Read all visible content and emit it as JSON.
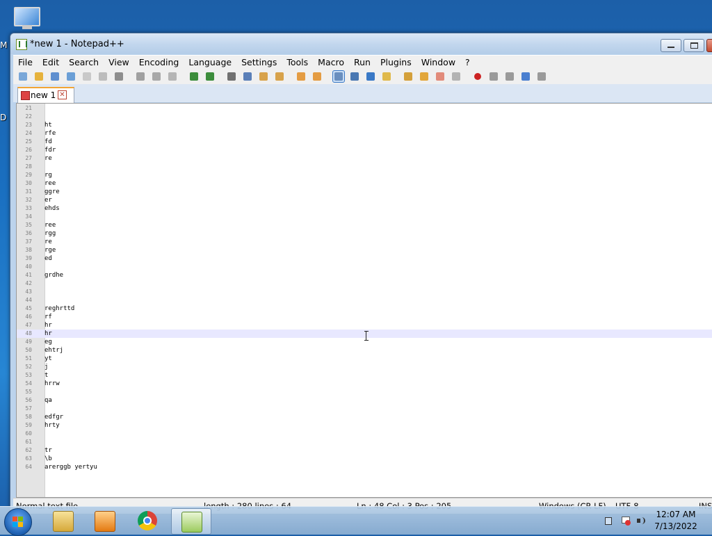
{
  "window": {
    "title": "*new 1 - Notepad++"
  },
  "desktop": {
    "left_letters": [
      "M",
      "D"
    ]
  },
  "menu": [
    "File",
    "Edit",
    "Search",
    "View",
    "Encoding",
    "Language",
    "Settings",
    "Tools",
    "Macro",
    "Run",
    "Plugins",
    "Window",
    "?"
  ],
  "toolbar_icons": [
    "new-file-icon",
    "open-file-icon",
    "save-icon",
    "save-all-icon",
    "close-icon",
    "close-all-icon",
    "print-icon",
    "cut-icon",
    "copy-icon",
    "paste-icon",
    "undo-icon",
    "redo-icon",
    "find-icon",
    "replace-icon",
    "zoom-in-icon",
    "zoom-out-icon",
    "sync-vertical-icon",
    "sync-horizontal-icon",
    "word-wrap-icon",
    "show-all-chars-icon",
    "indent-guide-icon",
    "user-language-icon",
    "doc-map-icon",
    "function-list-icon",
    "folder-workspace-icon",
    "monitoring-icon",
    "record-macro-icon",
    "stop-macro-icon",
    "play-macro-icon",
    "run-macro-multiple-icon",
    "save-macro-icon"
  ],
  "tab": {
    "label": "new 1"
  },
  "editor": {
    "current_line": 48,
    "lines": [
      {
        "n": "21",
        "t": ""
      },
      {
        "n": "22",
        "t": ""
      },
      {
        "n": "23",
        "t": "ht"
      },
      {
        "n": "24",
        "t": "rfe"
      },
      {
        "n": "25",
        "t": "fd"
      },
      {
        "n": "26",
        "t": "fdr"
      },
      {
        "n": "27",
        "t": "re"
      },
      {
        "n": "28",
        "t": ""
      },
      {
        "n": "29",
        "t": "rg"
      },
      {
        "n": "30",
        "t": "ree"
      },
      {
        "n": "31",
        "t": "ggre"
      },
      {
        "n": "32",
        "t": "er"
      },
      {
        "n": "33",
        "t": "ehds"
      },
      {
        "n": "34",
        "t": ""
      },
      {
        "n": "35",
        "t": "ree"
      },
      {
        "n": "36",
        "t": "rgg"
      },
      {
        "n": "37",
        "t": "re"
      },
      {
        "n": "38",
        "t": "rge"
      },
      {
        "n": "39",
        "t": "ed"
      },
      {
        "n": "40",
        "t": ""
      },
      {
        "n": "41",
        "t": "grdhe"
      },
      {
        "n": "42",
        "t": ""
      },
      {
        "n": "43",
        "t": ""
      },
      {
        "n": "44",
        "t": ""
      },
      {
        "n": "45",
        "t": "reghrttd"
      },
      {
        "n": "46",
        "t": "rf"
      },
      {
        "n": "47",
        "t": "hr"
      },
      {
        "n": "48",
        "t": "hr"
      },
      {
        "n": "49",
        "t": "eg"
      },
      {
        "n": "50",
        "t": "ehtrj"
      },
      {
        "n": "51",
        "t": "yt"
      },
      {
        "n": "52",
        "t": "j"
      },
      {
        "n": "53",
        "t": "t"
      },
      {
        "n": "54",
        "t": "hrrw"
      },
      {
        "n": "55",
        "t": ""
      },
      {
        "n": "56",
        "t": "qa"
      },
      {
        "n": "57",
        "t": ""
      },
      {
        "n": "58",
        "t": "edfgr"
      },
      {
        "n": "59",
        "t": "hrty"
      },
      {
        "n": "60",
        "t": ""
      },
      {
        "n": "61",
        "t": ""
      },
      {
        "n": "62",
        "t": "tr"
      },
      {
        "n": "63",
        "t": "\\b"
      },
      {
        "n": "64",
        "t": "arerggb yertyu"
      }
    ]
  },
  "status": {
    "file_type": "Normal text file",
    "length_lines": "length : 280    lines : 64",
    "position": "Ln : 48    Col : 3    Pos : 205",
    "eol": "Windows (CR LF)",
    "encoding": "UTF-8",
    "mode": "INS"
  },
  "taskbar": {
    "apps": [
      "file-explorer-icon",
      "media-player-icon",
      "chrome-icon",
      "notepad-plus-plus-icon"
    ],
    "time": "12:07 AM",
    "date": "7/13/2022"
  }
}
